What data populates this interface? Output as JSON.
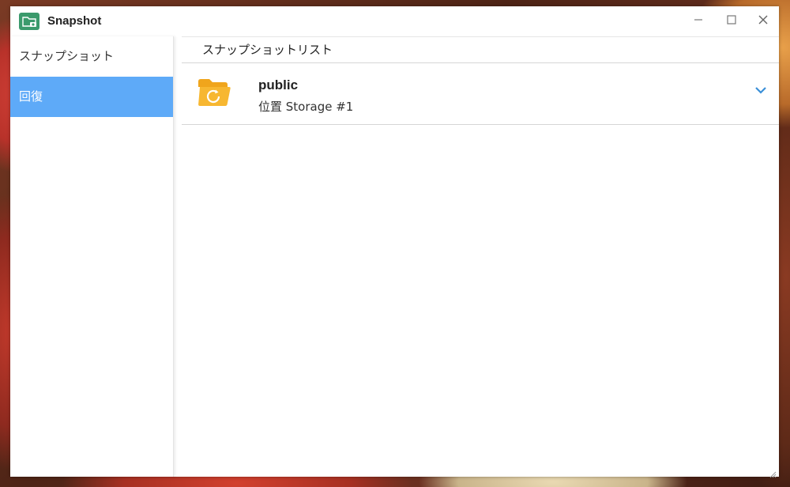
{
  "window": {
    "title": "Snapshot",
    "app_icon": "snapshot-app-icon"
  },
  "sidebar": {
    "items": [
      {
        "label": "スナップショット",
        "active": false
      },
      {
        "label": "回復",
        "active": true
      }
    ]
  },
  "main": {
    "header": "スナップショットリスト",
    "rows": [
      {
        "name": "public",
        "location": "位置 Storage #1",
        "icon": "folder-restore-icon",
        "expand_icon": "chevron-down-icon"
      }
    ]
  },
  "colors": {
    "accent": "#5eaaf8",
    "folder": "#f5b026",
    "chevron": "#3a8fd8",
    "app_icon": "#3b9a6c"
  }
}
